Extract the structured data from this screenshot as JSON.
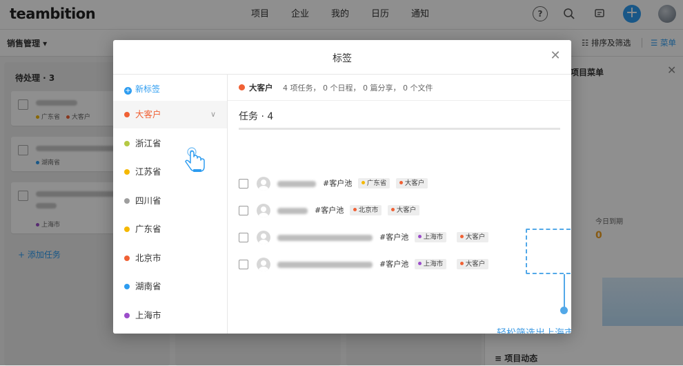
{
  "app": {
    "logo": "teambition",
    "nav": [
      "项目",
      "企业",
      "我的",
      "日历",
      "通知"
    ],
    "icons": {
      "help": "?",
      "search": "⌕",
      "chat": "▤",
      "add": "+"
    }
  },
  "project_bar": {
    "name": "销售管理 ▾",
    "filter_label": "☷ 排序及筛选",
    "menu_label": "☰ 菜单"
  },
  "board": {
    "title": "待处理 · 3",
    "cards": [
      {
        "tags": [
          {
            "label": "广东省",
            "color": "#f5b800"
          },
          {
            "label": "大客户",
            "color": "#f06135"
          }
        ]
      },
      {
        "tags": [
          {
            "label": "湖南省",
            "color": "#2d9cf0"
          }
        ]
      },
      {
        "tags": [
          {
            "label": "上海市",
            "color": "#9b4dca"
          }
        ]
      }
    ],
    "add_task": "+ 添加任务"
  },
  "right_panel": {
    "title": "项目菜单",
    "close": "✕",
    "stat_label": "今日到期",
    "stat_value": "0",
    "footer": "≡   项目动态"
  },
  "modal": {
    "title": "标签",
    "close": "✕",
    "new_tag": "新标签",
    "tags": [
      {
        "label": "大客户",
        "color": "#f06135",
        "active": true
      },
      {
        "label": "浙江省",
        "color": "#b5c945"
      },
      {
        "label": "江苏省",
        "color": "#f5b800"
      },
      {
        "label": "四川省",
        "color": "#9e9e9e"
      },
      {
        "label": "广东省",
        "color": "#f5b800"
      },
      {
        "label": "北京市",
        "color": "#f06135"
      },
      {
        "label": "湖南省",
        "color": "#2d9cf0"
      },
      {
        "label": "上海市",
        "color": "#9b4dca"
      }
    ],
    "tag_chevron": "∨",
    "info": {
      "name": "大客户",
      "stats": "4 项任务， 0 个日程， 0 篇分享， 0 个文件"
    },
    "tasks_heading": "任务 · 4",
    "tasks": [
      {
        "pool": "#客户池",
        "tags": [
          {
            "label": "广东省",
            "color": "#f5b800"
          },
          {
            "label": "大客户",
            "color": "#f06135"
          }
        ]
      },
      {
        "pool": "#客户池",
        "tags": [
          {
            "label": "北京市",
            "color": "#f06135"
          },
          {
            "label": "大客户",
            "color": "#f06135"
          }
        ]
      },
      {
        "pool": "#客户池",
        "tags": [
          {
            "label": "上海市",
            "color": "#9b4dca"
          },
          {
            "label": "大客户",
            "color": "#f06135"
          }
        ]
      },
      {
        "pool": "#客户池",
        "tags": [
          {
            "label": "上海市",
            "color": "#9b4dca"
          },
          {
            "label": "大客户",
            "color": "#f06135"
          }
        ]
      }
    ],
    "callout": "轻松筛选出上海市的大客户"
  }
}
